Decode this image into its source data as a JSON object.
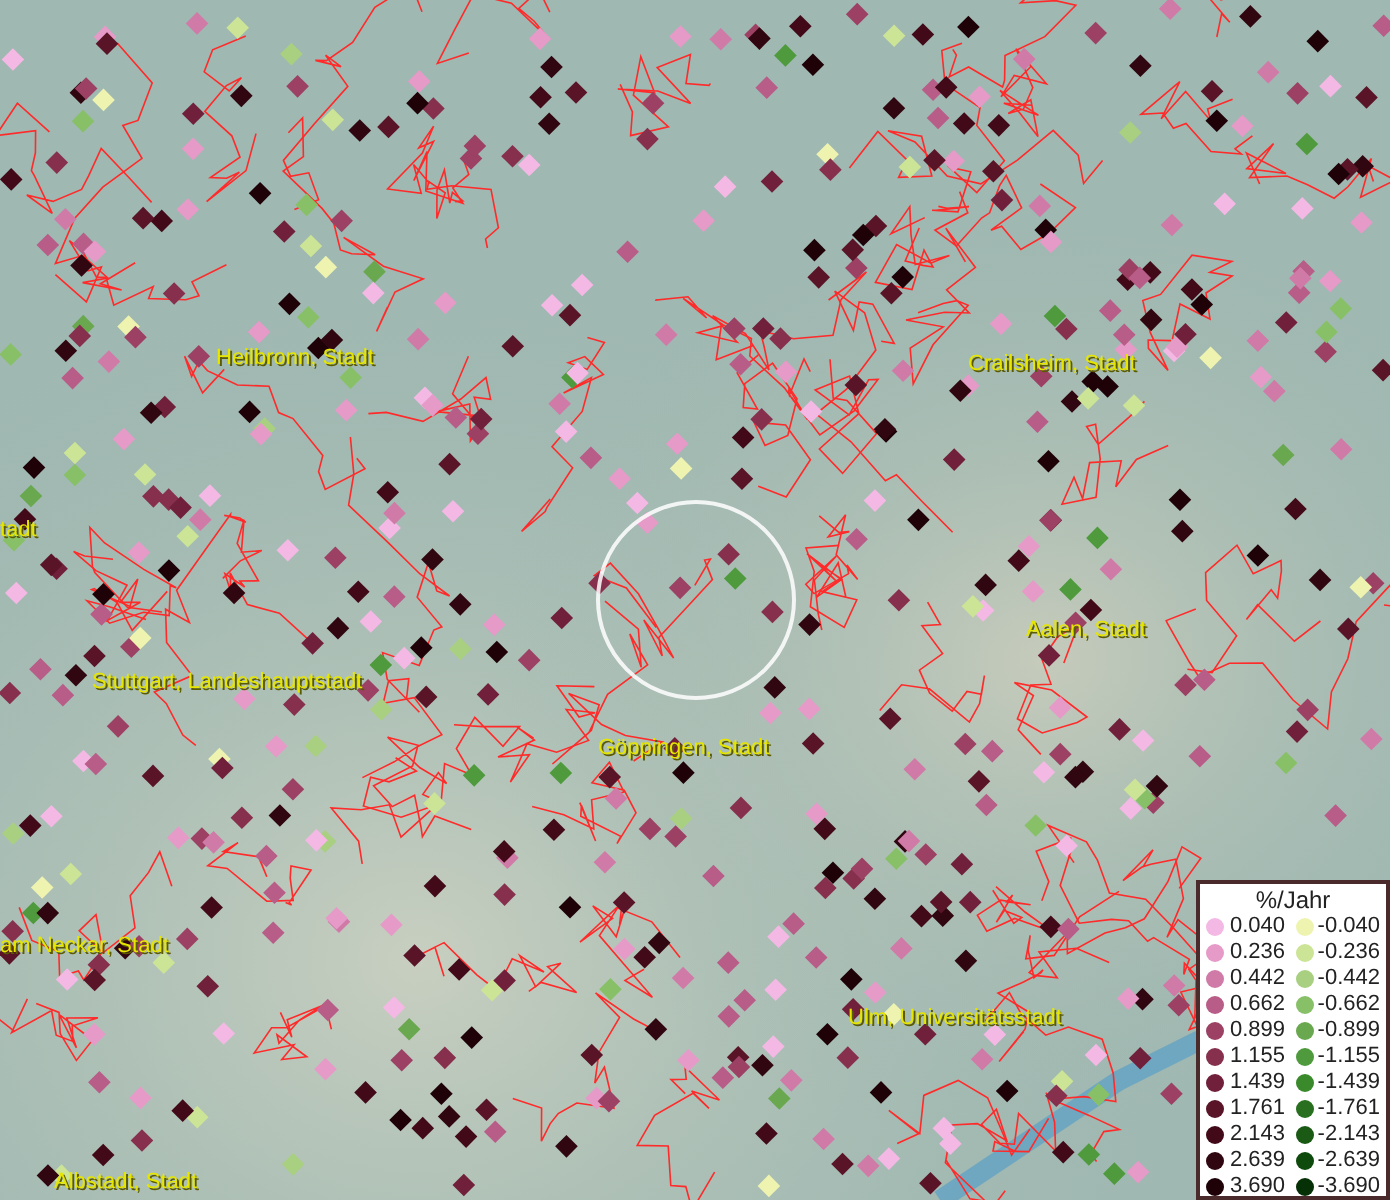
{
  "map": {
    "place_labels": [
      {
        "text": "Heilbronn, Stadt"
      },
      {
        "text": "Crailsheim, Stadt"
      },
      {
        "text": "tadt"
      },
      {
        "text": "Aalen, Stadt"
      },
      {
        "text": "Stuttgart, Landeshauptstadt"
      },
      {
        "text": "Göppingen, Stadt"
      },
      {
        "text": "am Neckar, Stadt"
      },
      {
        "text": "Ulm, Universitätsstadt"
      },
      {
        "text": "Albstadt, Stadt"
      }
    ]
  },
  "legend": {
    "title": "%/Jahr",
    "rows": [
      {
        "increase": {
          "value": "0.040",
          "color": "#f4b8e4"
        },
        "decrease": {
          "value": "-0.040",
          "color": "#eef4b0"
        }
      },
      {
        "increase": {
          "value": "0.236",
          "color": "#e69ac8"
        },
        "decrease": {
          "value": "-0.236",
          "color": "#cce496"
        }
      },
      {
        "increase": {
          "value": "0.442",
          "color": "#d07aa8"
        },
        "decrease": {
          "value": "-0.442",
          "color": "#a8d080"
        }
      },
      {
        "increase": {
          "value": "0.662",
          "color": "#b85c88"
        },
        "decrease": {
          "value": "-0.662",
          "color": "#88c068"
        }
      },
      {
        "increase": {
          "value": "0.899",
          "color": "#9c4064"
        },
        "decrease": {
          "value": "-0.899",
          "color": "#6aa850"
        }
      },
      {
        "increase": {
          "value": "1.155",
          "color": "#86304e"
        },
        "decrease": {
          "value": "-1.155",
          "color": "#4e9a3c"
        }
      },
      {
        "increase": {
          "value": "1.439",
          "color": "#70203a"
        },
        "decrease": {
          "value": "-1.439",
          "color": "#3a8a2c"
        }
      },
      {
        "increase": {
          "value": "1.761",
          "color": "#5a1428"
        },
        "decrease": {
          "value": "-1.761",
          "color": "#287020"
        }
      },
      {
        "increase": {
          "value": "2.143",
          "color": "#420a18"
        },
        "decrease": {
          "value": "-2.143",
          "color": "#1a5a14"
        }
      },
      {
        "increase": {
          "value": "2.639",
          "color": "#300610"
        },
        "decrease": {
          "value": "-2.639",
          "color": "#0e4a0c"
        }
      },
      {
        "increase": {
          "value": "3.690",
          "color": "#1e0208"
        },
        "decrease": {
          "value": "-3.690",
          "color": "#063006"
        }
      }
    ]
  }
}
